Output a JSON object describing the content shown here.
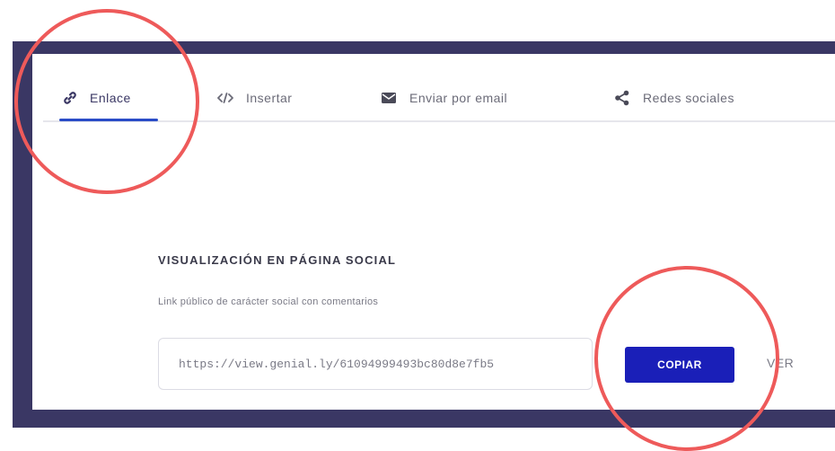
{
  "tabs": [
    {
      "label": "Enlace",
      "icon": "link-icon",
      "active": true
    },
    {
      "label": "Insertar",
      "icon": "code-icon",
      "active": false
    },
    {
      "label": "Enviar por email",
      "icon": "email-icon",
      "active": false
    },
    {
      "label": "Redes sociales",
      "icon": "share-icon",
      "active": false
    }
  ],
  "section": {
    "title": "VISUALIZACIÓN EN PÁGINA SOCIAL",
    "description": "Link público de carácter social con comentarios"
  },
  "url_field": {
    "value": "https://view.genial.ly/61094999493bc80d8e7fb5"
  },
  "copy_button": {
    "label": "COPIAR"
  },
  "view_link": {
    "label": "VER"
  },
  "colors": {
    "frame": "#3a3764",
    "accent": "#1a1fb8",
    "active_underline": "#2a4cc7",
    "annotation": "#ee5a5a"
  }
}
